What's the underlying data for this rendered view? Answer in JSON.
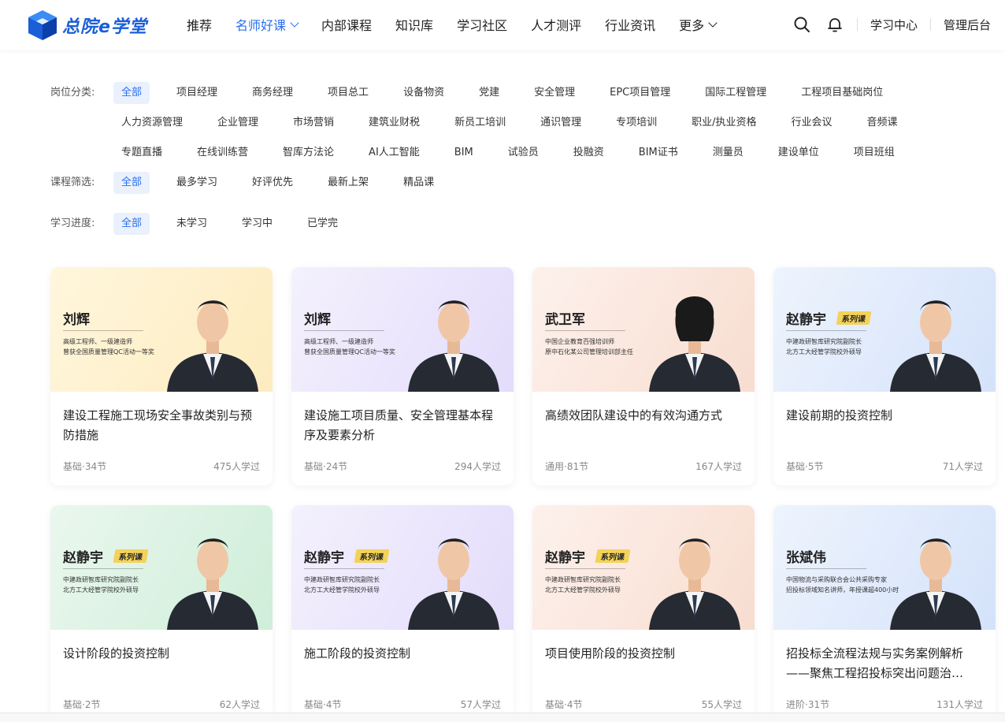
{
  "header": {
    "logo_text": "总院e学堂",
    "nav": [
      {
        "label": "推荐"
      },
      {
        "label": "名师好课"
      },
      {
        "label": "内部课程"
      },
      {
        "label": "知识库"
      },
      {
        "label": "学习社区"
      },
      {
        "label": "人才测评"
      },
      {
        "label": "行业资讯"
      },
      {
        "label": "更多"
      }
    ],
    "learning_center": "学习中心",
    "admin": "管理后台"
  },
  "filters": {
    "position_label": "岗位分类:",
    "positions": [
      "全部",
      "项目经理",
      "商务经理",
      "项目总工",
      "设备物资",
      "党建",
      "安全管理",
      "EPC项目管理",
      "国际工程管理",
      "工程项目基础岗位",
      "人力资源管理",
      "企业管理",
      "市场营销",
      "建筑业财税",
      "新员工培训",
      "通识管理",
      "专项培训",
      "职业/执业资格",
      "行业会议",
      "音频课",
      "专题直播",
      "在线训练营",
      "智库方法论",
      "AI人工智能",
      "BIM",
      "试验员",
      "投融资",
      "BIM证书",
      "测量员",
      "建设单位",
      "项目班组"
    ],
    "course_label": "课程筛选:",
    "courses": [
      "全部",
      "最多学习",
      "好评优先",
      "最新上架",
      "精品课"
    ],
    "progress_label": "学习进度:",
    "progress": [
      "全部",
      "未学习",
      "学习中",
      "已学完"
    ]
  },
  "cards": [
    {
      "teacher": "刘辉",
      "desc1": "高级工程师、一级建造师",
      "desc2": "曾获全国质量管理QC活动一等奖",
      "series": "",
      "title": "建设工程施工现场安全事故类别与预防措施",
      "meta": "基础·34节",
      "learners": "475人学过"
    },
    {
      "teacher": "刘辉",
      "desc1": "高级工程师、一级建造师",
      "desc2": "曾获全国质量管理QC活动一等奖",
      "series": "",
      "title": "建设施工项目质量、安全管理基本程序及要素分析",
      "meta": "基础·24节",
      "learners": "294人学过"
    },
    {
      "teacher": "武卫军",
      "desc1": "中国企业教育百强培训师",
      "desc2": "原中石化某公司管理培训部主任",
      "series": "",
      "title": "高绩效团队建设中的有效沟通方式",
      "meta": "通用·81节",
      "learners": "167人学过"
    },
    {
      "teacher": "赵静宇",
      "desc1": "中建政研智库研究院副院长",
      "desc2": "北方工大经管学院校外硕导",
      "series": "系列课",
      "title": "建设前期的投资控制",
      "meta": "基础·5节",
      "learners": "71人学过"
    },
    {
      "teacher": "赵静宇",
      "desc1": "中建政研智库研究院副院长",
      "desc2": "北方工大经管学院校外硕导",
      "series": "系列课",
      "title": "设计阶段的投资控制",
      "meta": "基础·2节",
      "learners": "62人学过"
    },
    {
      "teacher": "赵静宇",
      "desc1": "中建政研智库研究院副院长",
      "desc2": "北方工大经管学院校外硕导",
      "series": "系列课",
      "title": "施工阶段的投资控制",
      "meta": "基础·4节",
      "learners": "57人学过"
    },
    {
      "teacher": "赵静宇",
      "desc1": "中建政研智库研究院副院长",
      "desc2": "北方工大经管学院校外硕导",
      "series": "系列课",
      "title": "项目使用阶段的投资控制",
      "meta": "基础·4节",
      "learners": "55人学过"
    },
    {
      "teacher": "张斌伟",
      "desc1": "中国物流与采购联合会公共采购专家",
      "desc2": "招投标领域知名讲师，年授课超400小时",
      "series": "",
      "title": "招投标全流程法规与实务案例解析——聚焦工程招投标突出问题治…",
      "meta": "进阶·31节",
      "learners": "131人学过"
    }
  ]
}
